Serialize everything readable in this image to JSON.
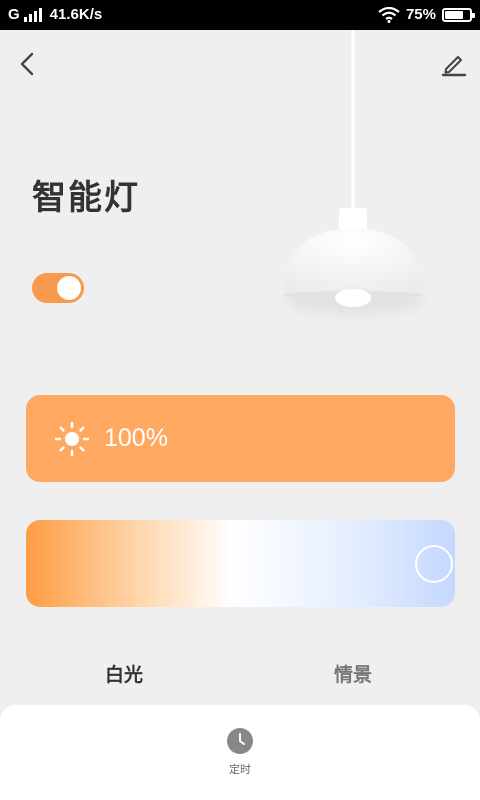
{
  "status_bar": {
    "network": "G",
    "speed": "41.6K/s",
    "battery_percent": "75%",
    "battery_level": 0.75
  },
  "header": {
    "back_icon": "chevron-left-icon",
    "edit_icon": "pencil-icon"
  },
  "device": {
    "name": "智能灯",
    "power_on": true
  },
  "brightness": {
    "icon": "sun-icon",
    "value": "100%"
  },
  "color_temperature": {
    "level": 1.0,
    "colors": {
      "warm": "#ff9c45",
      "neutral": "#ffffff",
      "cool": "#c4d8ff"
    }
  },
  "tabs": [
    {
      "label": "白光",
      "active": true
    },
    {
      "label": "情景",
      "active": false
    }
  ],
  "bottom": {
    "timer_label": "定时",
    "timer_icon": "clock-icon"
  },
  "colors": {
    "accent": "#f79a4e",
    "card": "#ffa862",
    "background": "#efefef"
  }
}
